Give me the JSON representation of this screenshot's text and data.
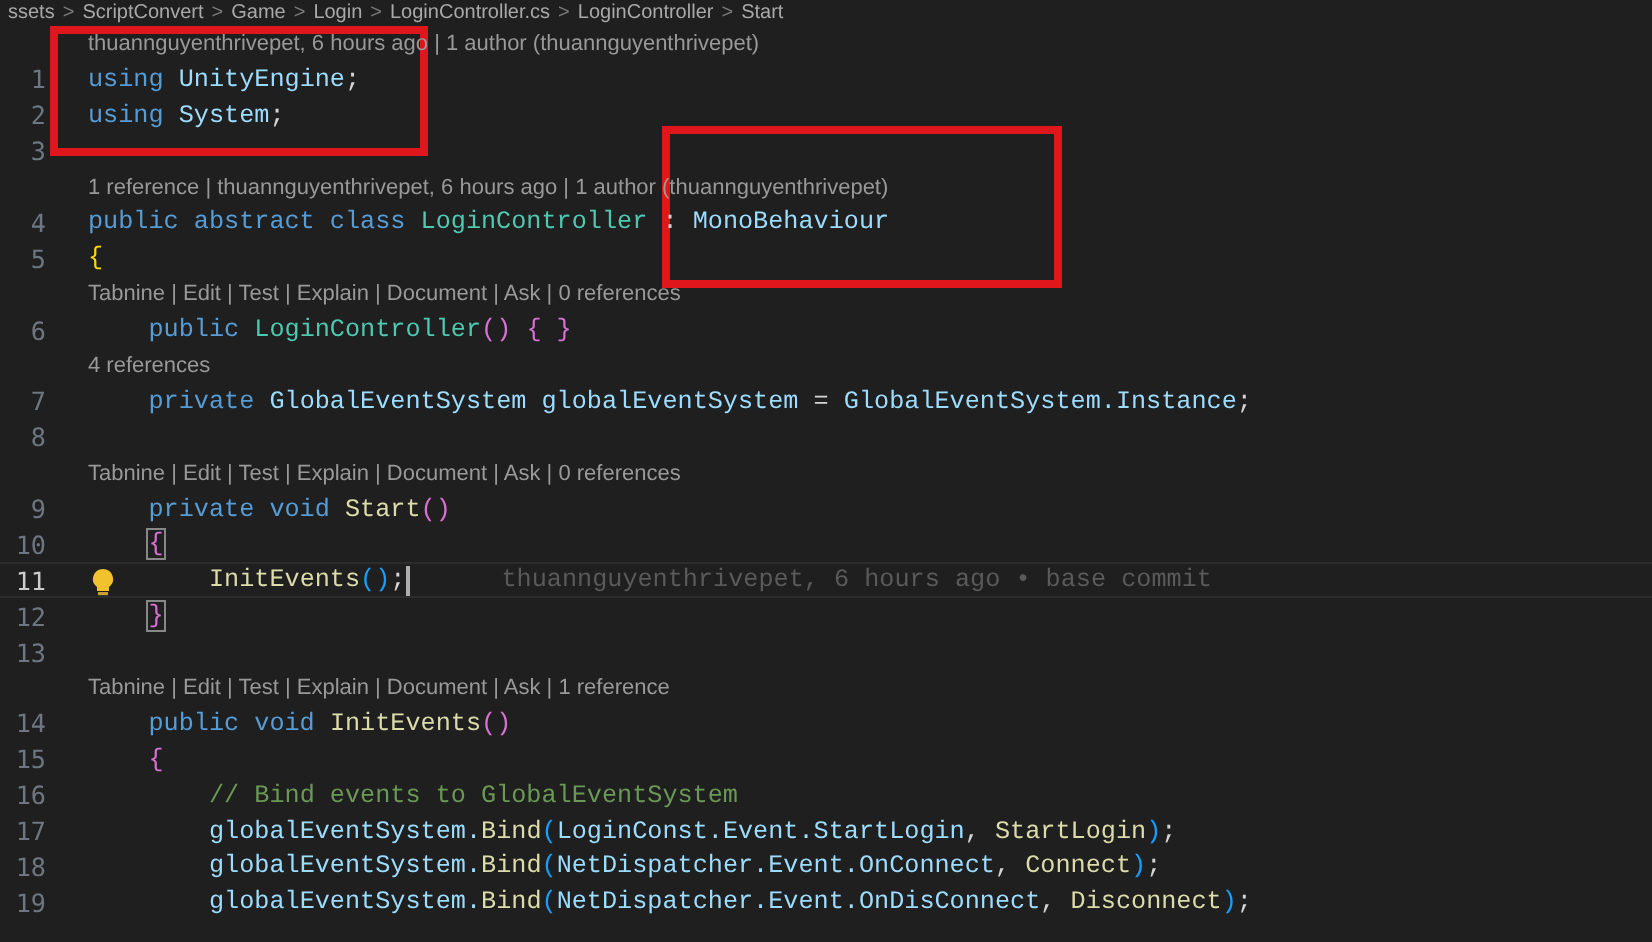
{
  "breadcrumb": [
    "ssets",
    "ScriptConvert",
    "Game",
    "Login",
    "LoginController.cs",
    "LoginController",
    "Start"
  ],
  "breadcrumb_separator": ">",
  "rows": [
    {
      "kind": "lens",
      "text": "thuannguyenthrivepet, 6 hours ago | 1 author (thuannguyenthrivepet)"
    },
    {
      "kind": "code",
      "number": "1",
      "current": false,
      "tokens": [
        {
          "text": "using ",
          "kind": "kw"
        },
        {
          "text": "UnityEngine",
          "kind": "var"
        },
        {
          "text": ";",
          "kind": "plain"
        }
      ]
    },
    {
      "kind": "code",
      "number": "2",
      "current": false,
      "tokens": [
        {
          "text": "using ",
          "kind": "kw"
        },
        {
          "text": "System",
          "kind": "var"
        },
        {
          "text": ";",
          "kind": "plain"
        }
      ]
    },
    {
      "kind": "code",
      "number": "3",
      "current": false,
      "tokens": []
    },
    {
      "kind": "lens",
      "text": "1 reference | thuannguyenthrivepet, 6 hours ago | 1 author (thuannguyenthrivepet)"
    },
    {
      "kind": "code",
      "number": "4",
      "current": false,
      "tokens": [
        {
          "text": "public abstract class ",
          "kind": "kw"
        },
        {
          "text": "LoginController",
          "kind": "type"
        },
        {
          "text": " : ",
          "kind": "plain"
        },
        {
          "text": "MonoBehaviour",
          "kind": "var"
        }
      ]
    },
    {
      "kind": "code",
      "number": "5",
      "current": false,
      "tokens": [
        {
          "text": "{",
          "kind": "b1"
        }
      ]
    },
    {
      "kind": "lens",
      "text": "Tabnine | Edit | Test | Explain | Document | Ask | 0 references"
    },
    {
      "kind": "code",
      "number": "6",
      "current": false,
      "tokens": [
        {
          "text": "    public ",
          "kind": "kw"
        },
        {
          "text": "LoginController",
          "kind": "type"
        },
        {
          "text": "() { }",
          "kind": "b2"
        }
      ]
    },
    {
      "kind": "lens",
      "text": "4 references"
    },
    {
      "kind": "code",
      "number": "7",
      "current": false,
      "tokens": [
        {
          "text": "    private ",
          "kind": "kw"
        },
        {
          "text": "GlobalEventSystem globalEventSystem",
          "kind": "var"
        },
        {
          "text": " = ",
          "kind": "plain"
        },
        {
          "text": "GlobalEventSystem.Instance",
          "kind": "var"
        },
        {
          "text": ";",
          "kind": "plain"
        }
      ]
    },
    {
      "kind": "code",
      "number": "8",
      "current": false,
      "tokens": []
    },
    {
      "kind": "lens",
      "text": "Tabnine | Edit | Test | Explain | Document | Ask | 0 references"
    },
    {
      "kind": "code",
      "number": "9",
      "current": false,
      "tokens": [
        {
          "text": "    private void ",
          "kind": "kw"
        },
        {
          "text": "Start",
          "kind": "fn"
        },
        {
          "text": "()",
          "kind": "b2"
        }
      ]
    },
    {
      "kind": "code",
      "number": "10",
      "current": false,
      "tokens": [
        {
          "text": "    {",
          "kind": "match"
        }
      ]
    },
    {
      "kind": "code",
      "number": "11",
      "current": true,
      "blame": "thuannguyenthrivepet, 6 hours ago • base commit",
      "tokens": [
        {
          "text": "        InitEvents",
          "kind": "fn"
        },
        {
          "text": "()",
          "kind": "b3"
        },
        {
          "text": ";",
          "kind": "plain"
        }
      ]
    },
    {
      "kind": "code",
      "number": "12",
      "current": false,
      "tokens": [
        {
          "text": "    }",
          "kind": "match"
        }
      ]
    },
    {
      "kind": "code",
      "number": "13",
      "current": false,
      "tokens": []
    },
    {
      "kind": "lens",
      "text": "Tabnine | Edit | Test | Explain | Document | Ask | 1 reference"
    },
    {
      "kind": "code",
      "number": "14",
      "current": false,
      "tokens": [
        {
          "text": "    public void ",
          "kind": "kw"
        },
        {
          "text": "InitEvents",
          "kind": "fn"
        },
        {
          "text": "()",
          "kind": "b2"
        }
      ]
    },
    {
      "kind": "code",
      "number": "15",
      "current": false,
      "tokens": [
        {
          "text": "    {",
          "kind": "b2"
        }
      ]
    },
    {
      "kind": "code",
      "number": "16",
      "current": false,
      "tokens": [
        {
          "text": "        // Bind events to GlobalEventSystem",
          "kind": "comment"
        }
      ]
    },
    {
      "kind": "code",
      "number": "17",
      "current": false,
      "tokens": [
        {
          "text": "        globalEventSystem.",
          "kind": "var"
        },
        {
          "text": "Bind",
          "kind": "fn"
        },
        {
          "text": "(",
          "kind": "b3"
        },
        {
          "text": "LoginConst.Event.StartLogin",
          "kind": "var"
        },
        {
          "text": ", ",
          "kind": "plain"
        },
        {
          "text": "StartLogin",
          "kind": "fn"
        },
        {
          "text": ")",
          "kind": "b3"
        },
        {
          "text": ";",
          "kind": "plain"
        }
      ]
    },
    {
      "kind": "code",
      "number": "18",
      "current": false,
      "tokens": [
        {
          "text": "        globalEventSystem.",
          "kind": "var"
        },
        {
          "text": "Bind",
          "kind": "fn"
        },
        {
          "text": "(",
          "kind": "b3"
        },
        {
          "text": "NetDispatcher.Event.OnConnect",
          "kind": "var"
        },
        {
          "text": ", ",
          "kind": "plain"
        },
        {
          "text": "Connect",
          "kind": "fn"
        },
        {
          "text": ")",
          "kind": "b3"
        },
        {
          "text": ";",
          "kind": "plain"
        }
      ]
    },
    {
      "kind": "code",
      "number": "19",
      "current": false,
      "tokens": [
        {
          "text": "        globalEventSystem.",
          "kind": "var"
        },
        {
          "text": "Bind",
          "kind": "fn"
        },
        {
          "text": "(",
          "kind": "b3"
        },
        {
          "text": "NetDispatcher.Event.OnDisConnect",
          "kind": "var"
        },
        {
          "text": ", ",
          "kind": "plain"
        },
        {
          "text": "Disconnect",
          "kind": "fn"
        },
        {
          "text": ")",
          "kind": "b3"
        },
        {
          "text": ";",
          "kind": "plain"
        }
      ]
    }
  ],
  "annotation_boxes": [
    {
      "kind": "rect"
    },
    {
      "kind": "rect"
    }
  ]
}
